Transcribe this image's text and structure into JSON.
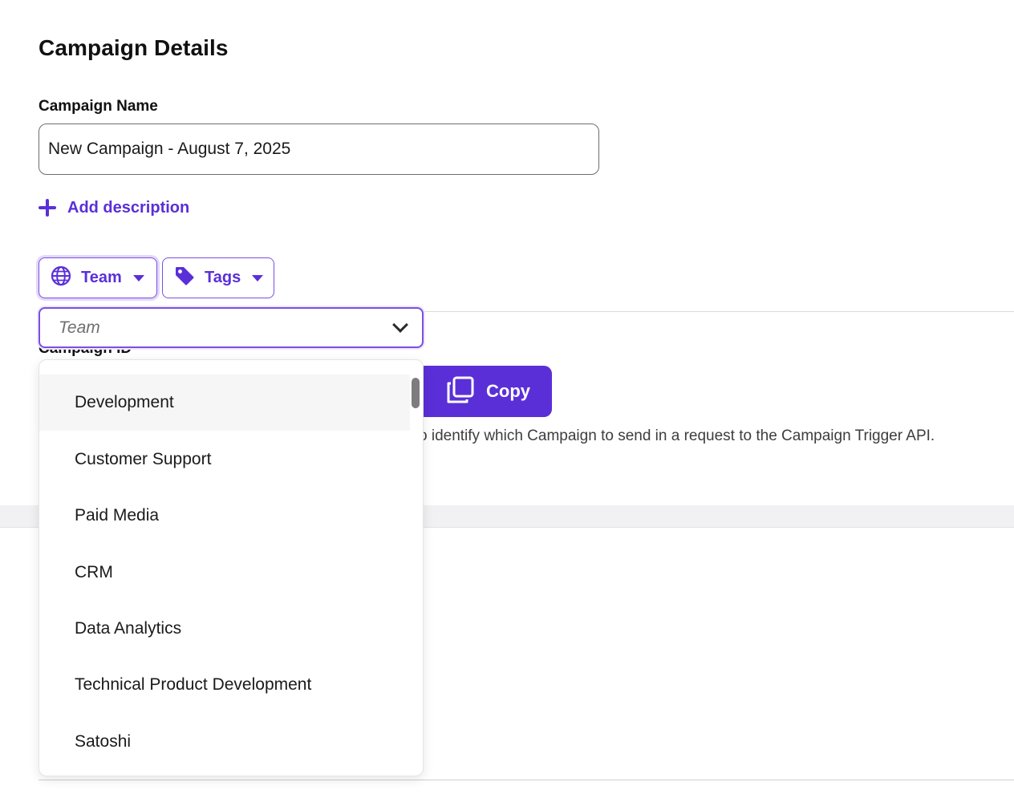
{
  "page": {
    "title": "Campaign Details"
  },
  "campaign_name": {
    "label": "Campaign Name",
    "value": "New Campaign - August 7, 2025"
  },
  "add_description": {
    "label": "Add description"
  },
  "chips": {
    "team": {
      "label": "Team",
      "icon": "globe-icon"
    },
    "tags": {
      "label": "Tags",
      "icon": "tag-icon"
    }
  },
  "team_select": {
    "placeholder": "Team",
    "options": [
      "Development",
      "Customer Support",
      "Paid Media",
      "CRM",
      "Data Analytics",
      "Technical Product Development",
      "Satoshi"
    ],
    "hovered_option": "Development"
  },
  "campaign_id": {
    "label": "Campaign ID",
    "copy_label": "Copy",
    "help_text": "o identify which Campaign to send in a request to the Campaign Trigger API."
  },
  "colors": {
    "accent": "#5a2fd8",
    "accent_border": "#7a4fe3",
    "hover_bg": "#f6f6f6"
  }
}
